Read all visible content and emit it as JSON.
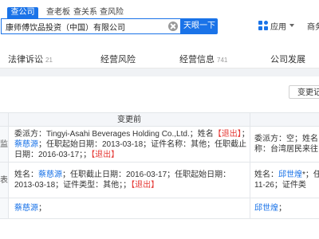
{
  "search": {
    "tabs": [
      "查公司",
      "查老板",
      "查关系",
      "查风险"
    ],
    "query": "康师傅饮品投资（中国）有限公司",
    "button": "天眼一下"
  },
  "header": {
    "apps_label": "应用",
    "shang_label": "商务"
  },
  "nav": {
    "items": [
      {
        "label": "法律诉讼",
        "count": "21"
      },
      {
        "label": "经营风险",
        "count": ""
      },
      {
        "label": "经营信息",
        "count": "741"
      },
      {
        "label": "公司发展",
        "count": ""
      }
    ]
  },
  "change_button": "变更记",
  "table": {
    "header": "变更前",
    "rows": [
      {
        "left": "监",
        "before": [
          {
            "t": "委派方：Tingyi-Asahi Beverages Holding Co.,Ltd.；姓名",
            "c": ""
          },
          {
            "t": "【退出】",
            "c": "red"
          },
          {
            "t": "；",
            "c": ""
          },
          {
            "t": "蔡慈源",
            "c": "link"
          },
          {
            "t": "；任职起始日期：2013-03-18；证件名称：其他；任职截止日期：2016-03-17；；",
            "c": ""
          },
          {
            "t": "【退出】",
            "c": "red"
          }
        ],
        "after": [
          {
            "t": "委派方：空；姓名",
            "c": ""
          },
          {
            "t": "称：台湾居民来往",
            "c": ""
          }
        ]
      },
      {
        "left": "表",
        "before": [
          {
            "t": "姓名：",
            "c": ""
          },
          {
            "t": "蔡慈源",
            "c": "link"
          },
          {
            "t": "；任职截止日期：2016-03-17；任职起始日期：2013-03-18；证件类型：其他；；",
            "c": ""
          },
          {
            "t": "【退出】",
            "c": "red"
          }
        ],
        "after": [
          {
            "t": "姓名：",
            "c": ""
          },
          {
            "t": "邱世煌",
            "c": "link"
          },
          {
            "t": "*；任",
            "c": ""
          },
          {
            "t": "11-26；证件类",
            "c": ""
          }
        ]
      },
      {
        "left": "",
        "before": [
          {
            "t": "蔡慈源",
            "c": "link"
          },
          {
            "t": "；",
            "c": ""
          }
        ],
        "after": [
          {
            "t": "邱世煌",
            "c": "link"
          },
          {
            "t": "；",
            "c": ""
          }
        ]
      }
    ]
  },
  "colors": {
    "accent": "#1a73e8",
    "exit_red": "#e53935"
  }
}
